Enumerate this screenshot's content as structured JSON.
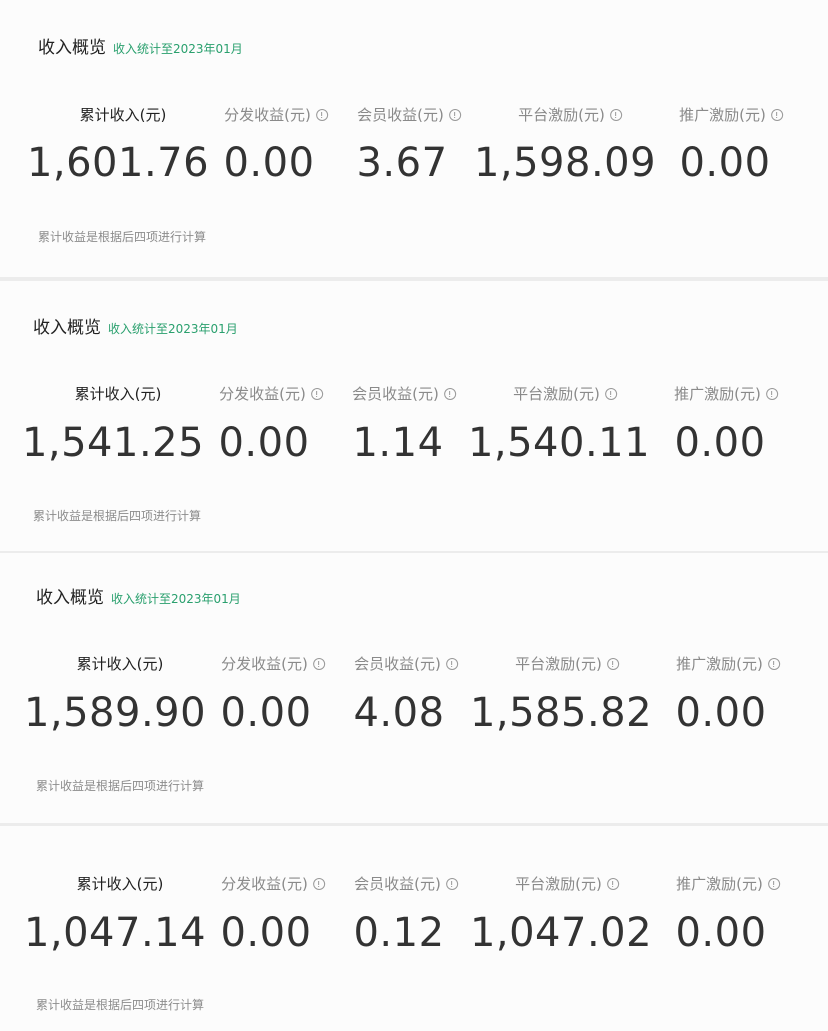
{
  "cards": [
    {
      "title": "收入概览",
      "subtitle": "收入统计至2023年01月",
      "metrics": [
        {
          "label": "累计收入(元)",
          "value": "1,601.76"
        },
        {
          "label": "分发收益(元)",
          "value": "0.00"
        },
        {
          "label": "会员收益(元)",
          "value": "3.67"
        },
        {
          "label": "平台激励(元)",
          "value": "1,598.09"
        },
        {
          "label": "推广激励(元)",
          "value": "0.00"
        }
      ],
      "note": "累计收益是根据后四项进行计算"
    },
    {
      "title": "收入概览",
      "subtitle": "收入统计至2023年01月",
      "metrics": [
        {
          "label": "累计收入(元)",
          "value": "1,541.25"
        },
        {
          "label": "分发收益(元)",
          "value": "0.00"
        },
        {
          "label": "会员收益(元)",
          "value": "1.14"
        },
        {
          "label": "平台激励(元)",
          "value": "1,540.11"
        },
        {
          "label": "推广激励(元)",
          "value": "0.00"
        }
      ],
      "note": "累计收益是根据后四项进行计算"
    },
    {
      "title": "收入概览",
      "subtitle": "收入统计至2023年01月",
      "metrics": [
        {
          "label": "累计收入(元)",
          "value": "1,589.90"
        },
        {
          "label": "分发收益(元)",
          "value": "0.00"
        },
        {
          "label": "会员收益(元)",
          "value": "4.08"
        },
        {
          "label": "平台激励(元)",
          "value": "1,585.82"
        },
        {
          "label": "推广激励(元)",
          "value": "0.00"
        }
      ],
      "note": "累计收益是根据后四项进行计算"
    },
    {
      "metrics": [
        {
          "label": "累计收入(元)",
          "value": "1,047.14"
        },
        {
          "label": "分发收益(元)",
          "value": "0.00"
        },
        {
          "label": "会员收益(元)",
          "value": "0.12"
        },
        {
          "label": "平台激励(元)",
          "value": "1,047.02"
        },
        {
          "label": "推广激励(元)",
          "value": "0.00"
        }
      ],
      "note": "累计收益是根据后四项进行计算"
    }
  ],
  "icons": {
    "info": "info-circle-icon"
  }
}
